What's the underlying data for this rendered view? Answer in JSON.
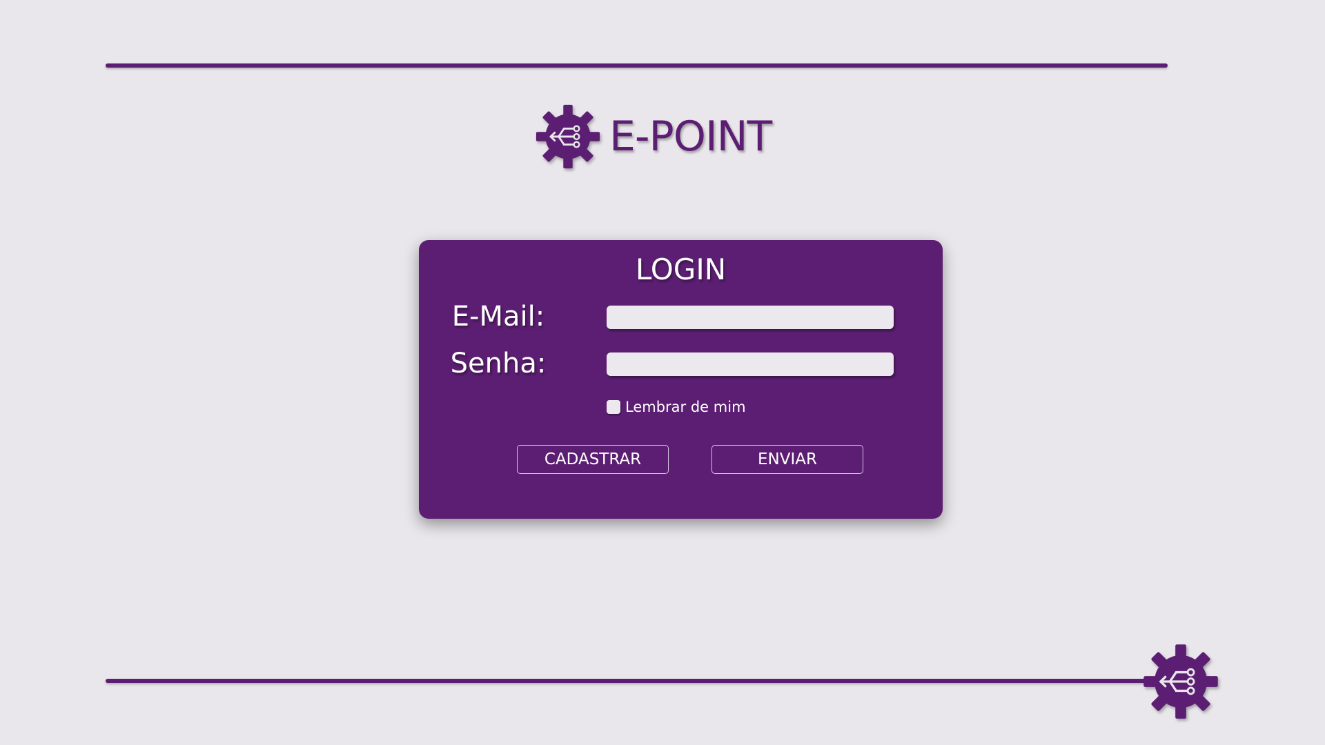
{
  "brand": {
    "name": "E-POINT",
    "color": "#5c1e72",
    "logo_icon": "gear-circuit-icon"
  },
  "login": {
    "title": "LOGIN",
    "email_label": "E-Mail:",
    "email_value": "",
    "password_label": "Senha:",
    "password_value": "",
    "remember_label": "Lembrar de mim",
    "remember_checked": false,
    "register_button": "CADASTRAR",
    "submit_button": "ENVIAR"
  },
  "colors": {
    "background": "#e9e7eb",
    "card": "#5c1e72",
    "input": "#ece9ee"
  }
}
